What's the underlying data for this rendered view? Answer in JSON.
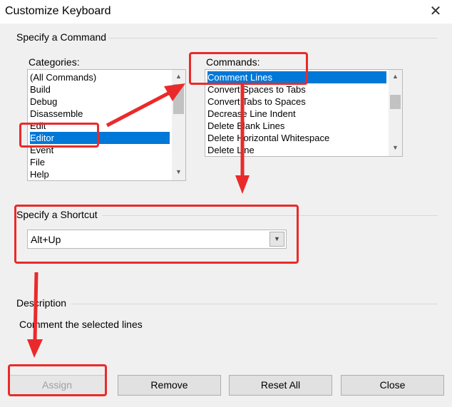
{
  "window": {
    "title": "Customize Keyboard",
    "close_glyph": "✕"
  },
  "command_group": {
    "label": "Specify a Command"
  },
  "categories": {
    "label": "Categories:",
    "items": [
      "(All Commands)",
      "Build",
      "Debug",
      "Disassemble",
      "Edit",
      "Editor",
      "Event",
      "File",
      "Help"
    ],
    "selected": "Editor"
  },
  "commands": {
    "label": "Commands:",
    "items": [
      "Comment Lines",
      "Convert Spaces to Tabs",
      "Convert Tabs to Spaces",
      "Decrease Line Indent",
      "Delete Blank Lines",
      "Delete Horizontal Whitespace",
      "Delete Line"
    ],
    "selected": "Comment Lines"
  },
  "shortcut": {
    "label": "Specify a Shortcut",
    "value": "Alt+Up"
  },
  "description": {
    "label": "Description",
    "text": "Comment the selected lines"
  },
  "buttons": {
    "assign": "Assign",
    "remove": "Remove",
    "reset_all": "Reset All",
    "close": "Close"
  },
  "annotation_color": "#ea2a2a",
  "selection_color": "#0078d7"
}
